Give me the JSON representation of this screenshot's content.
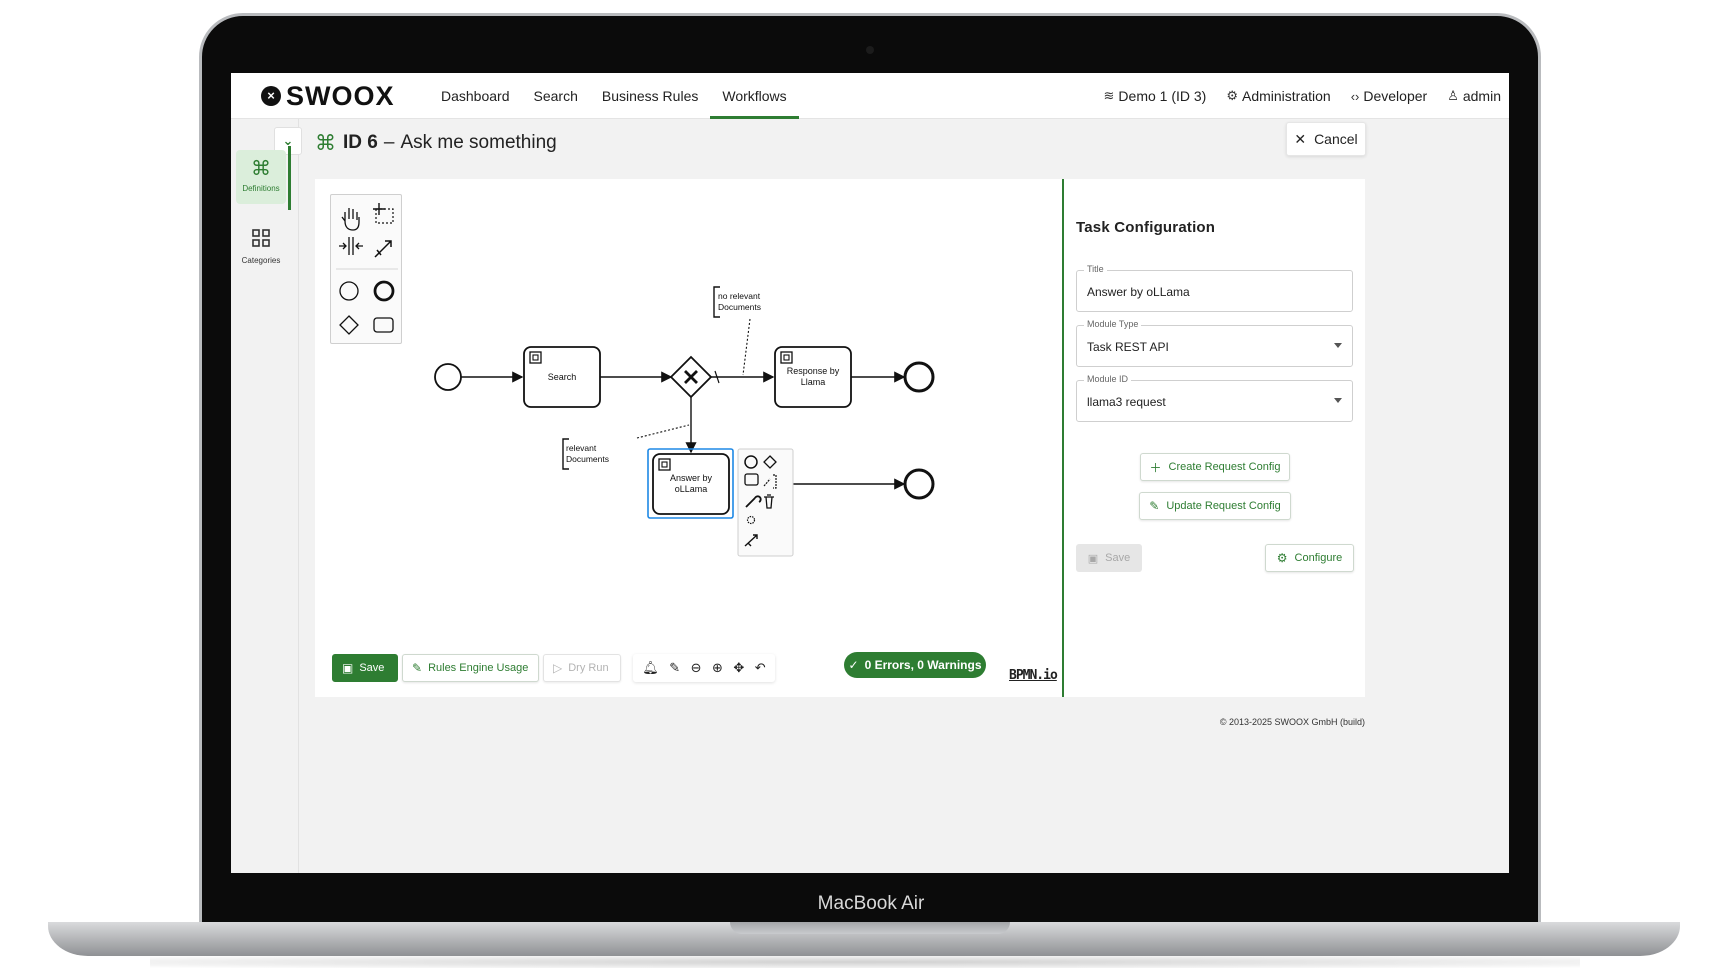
{
  "device": {
    "label": "MacBook Air"
  },
  "app": {
    "logo_text": "SWOOX",
    "nav": [
      "Dashboard",
      "Search",
      "Business Rules",
      "Workflows"
    ],
    "active_nav": "Workflows",
    "nav_right": [
      {
        "icon": "layers-icon",
        "label": "Demo 1 (ID 3)"
      },
      {
        "icon": "gear-icon",
        "label": "Administration"
      },
      {
        "icon": "code-icon",
        "label": "Developer"
      },
      {
        "icon": "user-icon",
        "label": "admin"
      }
    ]
  },
  "sidebar": {
    "items": [
      {
        "label": "Definitions",
        "icon": "command-icon",
        "active": true
      },
      {
        "label": "Categories",
        "icon": "grid-icon",
        "active": false
      }
    ]
  },
  "page": {
    "id_label": "ID 6",
    "separator": "–",
    "title": "Ask me something",
    "cancel_label": "Cancel"
  },
  "diagram": {
    "tasks": {
      "search": "Search",
      "response_line1": "Response by",
      "response_line2": "Llama",
      "answer_line1": "Answer by",
      "answer_line2": "oLLama"
    },
    "annotations": {
      "no_relevant_line1": "no relevant",
      "no_relevant_line2": "Documents",
      "relevant_line1": "relevant",
      "relevant_line2": "Documents"
    }
  },
  "toolbar": {
    "save_label": "Save",
    "rules_label": "Rules Engine Usage",
    "dry_run_label": "Dry Run",
    "status": "0 Errors, 0 Warnings",
    "brand": "BPMN.io"
  },
  "config": {
    "heading": "Task Configuration",
    "title_label": "Title",
    "title_value": "Answer by oLLama",
    "module_type_label": "Module Type",
    "module_type_value": "Task REST API",
    "module_id_label": "Module ID",
    "module_id_value": "llama3 request",
    "create_label": "Create Request Config",
    "update_label": "Update Request Config",
    "save_label": "Save",
    "configure_label": "Configure"
  },
  "footer": {
    "copyright": "© 2013-2025 SWOOX GmbH (build)"
  },
  "colors": {
    "accent": "#2e7d32",
    "selection": "#1e88e5"
  }
}
